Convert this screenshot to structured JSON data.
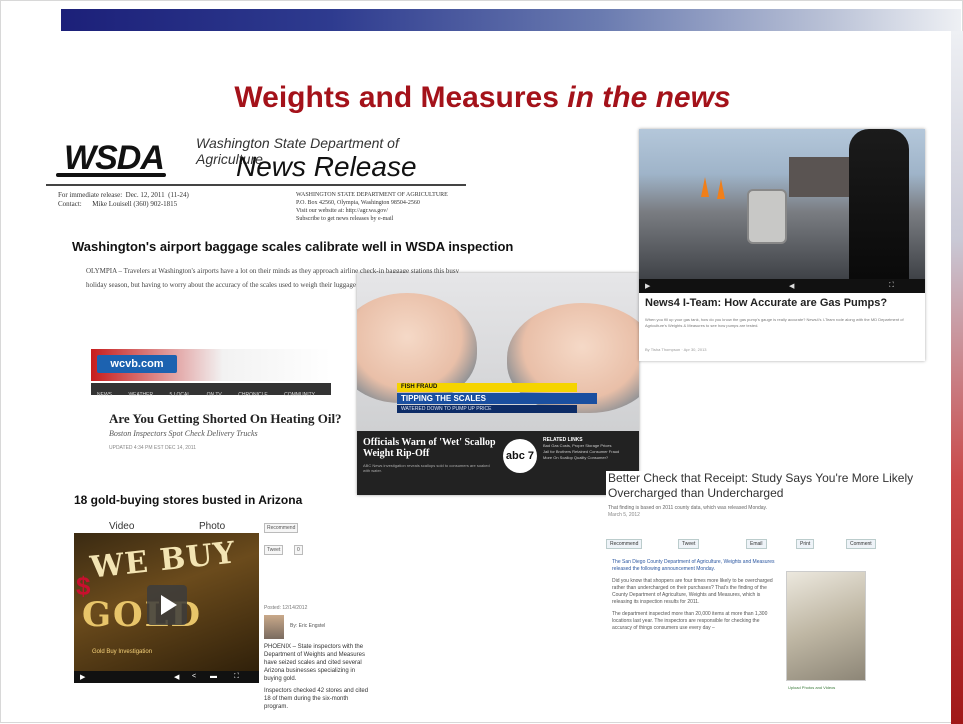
{
  "slide": {
    "title_main": "Weights and Measures",
    "title_italic": "in the news"
  },
  "wsda": {
    "logo": "WSDA",
    "department": "Washington State Department of Agriculture",
    "doc_type": "News Release",
    "meta_left": "For immediate release:  Dec. 12, 2011  (11-24)\nContact:      Mike Louisell (360) 902-1815",
    "meta_right": "WASHINGTON STATE DEPARTMENT OF AGRICULTURE\nP.O. Box 42560, Olympia, Washington 98504-2560\nVisit our website at: http://agr.wa.gov/\nSubscribe to get news releases by e-mail",
    "headline": "Washington's airport baggage scales calibrate well in WSDA inspection",
    "body": "OLYMPIA – Travelers at Washington's airports have a lot on their minds as they approach airline check-in baggage stations this busy holiday season, but having to worry about the accuracy of the scales used to weigh their luggage shouldn't cause concern."
  },
  "wcvb": {
    "logo": "wcvb.com",
    "nav": [
      "NEWS",
      "WEATHER",
      "5 LOCAL",
      "ON TV",
      "CHRONICLE",
      "COMMUNITY"
    ],
    "headline": "Are You Getting Shorted On Heating Oil?",
    "subhead": "Boston Inspectors Spot Check Delivery Trucks",
    "byline": "UPDATED 4:34 PM EST DEC 14, 2011"
  },
  "gold": {
    "headline": "18 gold-buying stores busted in Arizona",
    "tab_video": "Video",
    "tab_photo": "Photo",
    "video_text_1": "WE BUY",
    "video_text_2": "GOLD",
    "video_caption": "Gold Buy Investigation",
    "share_recommend": "Recommend",
    "share_tweet": "Tweet",
    "share_count": "0",
    "posted": "Posted: 12/14/2012",
    "author": "By: Eric Engstel",
    "body_1": "PHOENIX – State inspectors with the Department of Weights and Measures have seized scales and cited several Arizona businesses specializing in buying gold.",
    "body_2": "Inspectors checked 42 stores and cited 18 of them during the six-month program."
  },
  "scallop": {
    "banner_1": "FISH FRAUD",
    "banner_2": "TIPPING THE SCALES",
    "banner_3": "WATERED DOWN TO PUMP UP PRICE",
    "title": "Officials Warn of 'Wet' Scallop Weight Rip-Off",
    "desc": "ABC News investigation reveals scallops sold to consumers are soaked with water.",
    "station_logo": "abc 7",
    "related_heading": "RELATED LINKS",
    "related_1": "Bad Gas Costs, Proper Storage Prices",
    "related_2": "Jail for Brothers Retained Consumer Fraud",
    "related_3": "More On Scallop Quality Consumer?"
  },
  "gas": {
    "title": "News4 I-Team: How Accurate are Gas Pumps?",
    "desc": "When you fill up your gas tank, how do you know the gas pump's gauge is really accurate? News4's I-Team rode along with the MD Department of Agriculture's Weights & Measures to see how pumps are tested.",
    "byline": "By Tisha Thompson  ·  Apr 30, 2013"
  },
  "receipt": {
    "title": "Better Check that Receipt: Study Says You're More Likely Overcharged than Undercharged",
    "dek": "That finding is based on 2011 county data, which was released Monday.",
    "date": "March 5, 2012",
    "share": [
      "Recommend",
      "Tweet",
      "Email",
      "Print",
      "Comment"
    ],
    "lede": "The San Diego County Department of Agriculture, Weights and Measures released the following announcement Monday.",
    "body_1": "Did you know that shoppers are four times more likely to be overcharged rather than undercharged on their purchases? That's the finding of the County Department of Agriculture, Weights and Measures, which is releasing its inspection results for 2011.",
    "body_2": "The department inspected more than 20,000 items at more than 1,300 locations last year. The inspectors are responsible for checking the accuracy of things consumers use every day –",
    "photo_caption": "Upload Photos and Videos"
  }
}
